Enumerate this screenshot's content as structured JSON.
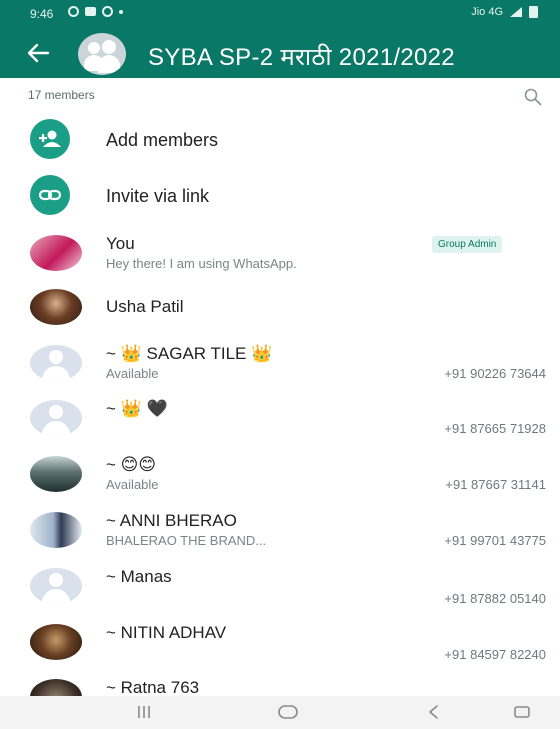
{
  "status_bar": {
    "time": "9:46",
    "network_text": "Jio 4G"
  },
  "header": {
    "title": "SYBA SP-2 मराठी 2021/2022"
  },
  "members_section": {
    "count_label": "17 members"
  },
  "actions": [
    {
      "label": "Add members",
      "icon": "add-person-icon"
    },
    {
      "label": "Invite via link",
      "icon": "link-icon"
    }
  ],
  "members": [
    {
      "name": "You",
      "about": "Hey there! I am using WhatsApp.",
      "phone": "",
      "badge": "Group Admin"
    },
    {
      "name": "Usha Patil",
      "about": "",
      "phone": "",
      "badge": ""
    },
    {
      "name": "~ 👑 SAGAR TILE 👑",
      "about": "Available",
      "phone": "+91 90226 73644",
      "badge": ""
    },
    {
      "name": "~ 👑 🖤",
      "about": "",
      "phone": "+91 87665 71928",
      "badge": ""
    },
    {
      "name": "~ 😊😊",
      "about": "Available",
      "phone": "+91 87667 31141",
      "badge": ""
    },
    {
      "name": "~ ANNI BHERAO",
      "about": "BHALERAO THE BRAND...",
      "phone": "+91 99701 43775",
      "badge": ""
    },
    {
      "name": "~ Manas",
      "about": "",
      "phone": "+91 87882 05140",
      "badge": ""
    },
    {
      "name": "~ NITIN ADHAV",
      "about": "",
      "phone": "+91 84597 82240",
      "badge": ""
    },
    {
      "name": "~ Ratna 763",
      "about": "",
      "phone": "",
      "badge": ""
    }
  ],
  "colors": {
    "app_bar": "#0a7866",
    "accent": "#1a9e86",
    "badge_bg": "#dff3ee"
  }
}
